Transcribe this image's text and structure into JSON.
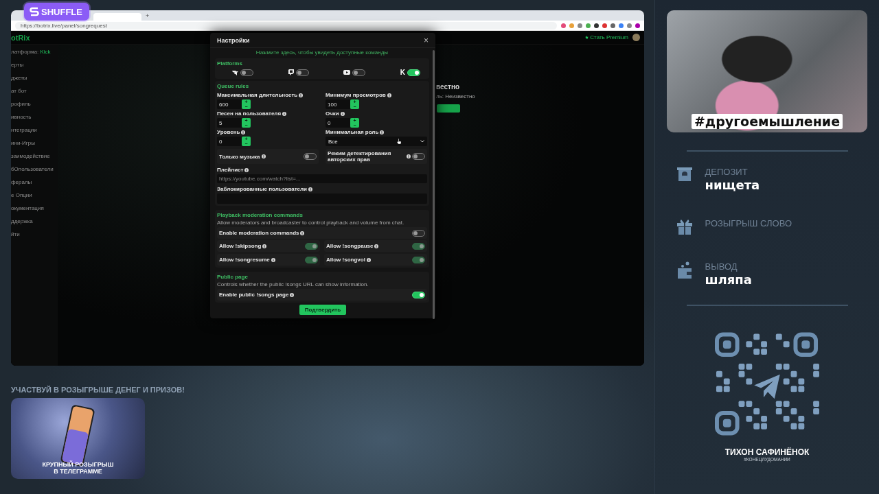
{
  "badge": {
    "label": "SHUFFLE"
  },
  "browser": {
    "url": "https://botrix.live/panel/songrequest",
    "new_tab": "+"
  },
  "app": {
    "logo": "otRix",
    "premium": "Стать Premium",
    "platform_label": "латформа:",
    "platform_value": "Kick",
    "sidebar_items": [
      "ерты",
      "джеты",
      "ат бот",
      "рофиль",
      "ивность",
      "нтеграции",
      "ини-Игры",
      "заимодействие",
      "бОпользователи",
      "фералы",
      "е Опции",
      "окументация",
      "ддержка",
      "йти"
    ],
    "behind_title": "вестно",
    "behind_text": "ль: Неизвестно"
  },
  "modal": {
    "title": "Настройки",
    "close": "×",
    "hint": "Нажмите здесь, чтобы увидеть доступные команды",
    "platforms": {
      "title": "Platforms",
      "items": [
        {
          "kind": "bot",
          "on": false
        },
        {
          "kind": "twitch",
          "on": false
        },
        {
          "kind": "youtube",
          "on": false
        },
        {
          "kind": "kick",
          "logo_text": "K",
          "on": true
        }
      ]
    },
    "queue": {
      "title": "Queue rules",
      "fields": [
        {
          "kind": "number",
          "label": "Максимальная длительность",
          "value": "600",
          "plus": "+",
          "minus": "−"
        },
        {
          "kind": "number",
          "label": "Минимум просмотров",
          "value": "100",
          "plus": "+",
          "minus": "−"
        },
        {
          "kind": "number",
          "label": "Песен на пользователя",
          "value": "5",
          "plus": "+",
          "minus": "−"
        },
        {
          "kind": "number",
          "label": "Очки",
          "value": "0",
          "plus": "+",
          "minus": "−"
        },
        {
          "kind": "number",
          "label": "Уровень",
          "value": "0",
          "plus": "+",
          "minus": "−"
        },
        {
          "kind": "select",
          "label": "Минимальная роль",
          "value": "Все"
        }
      ],
      "toggles": [
        {
          "label": "Только музыка",
          "on": false
        },
        {
          "label": "Режим детектирования авторских прав",
          "on": false
        }
      ],
      "playlist": {
        "label": "Плейлист",
        "placeholder": "https://youtube.com/watch?list=..."
      },
      "blocked": {
        "label": "Заблокированные пользователи"
      }
    },
    "moderation": {
      "title": "Playback moderation commands",
      "description": "Allow moderators and broadcaster to control playback and volume from chat.",
      "master": {
        "label": "Enable moderation commands",
        "on": false
      },
      "commands": [
        {
          "label": "Allow !skipsong",
          "on": true,
          "disabled": true
        },
        {
          "label": "Allow !songpause",
          "on": true,
          "disabled": true
        },
        {
          "label": "Allow !songresume",
          "on": true,
          "disabled": true
        },
        {
          "label": "Allow !songvol",
          "on": true,
          "disabled": true
        }
      ]
    },
    "public": {
      "title": "Public page",
      "description": "Controls whether the public !songs URL can show information.",
      "toggle": {
        "label": "Enable public !songs page",
        "on": true
      }
    },
    "confirm": "Подтвердить"
  },
  "promo": {
    "heading": "УЧАСТВУЙ В РОЗЫГРЫШЕ ДЕНЕГ И ПРИЗОВ!",
    "card_lines": [
      "КРУПНЫЙ РОЗЫГРЫШ",
      "В ТЕЛЕГРАММЕ"
    ]
  },
  "side": {
    "banner_caption": "#другоемышление",
    "stats": [
      {
        "kind": "deposit",
        "label": "ДЕПОЗИТ",
        "value": "нищета"
      },
      {
        "kind": "gift",
        "label": "РОЗЫГРЫШ СЛОВО"
      },
      {
        "kind": "wallet",
        "label": "ВЫВОД",
        "value": "шляпа"
      }
    ],
    "qr_name": "ТИХОН САФИНЁНОК",
    "qr_tag": "#КОНЕЦЛУДОМАНИИ"
  }
}
